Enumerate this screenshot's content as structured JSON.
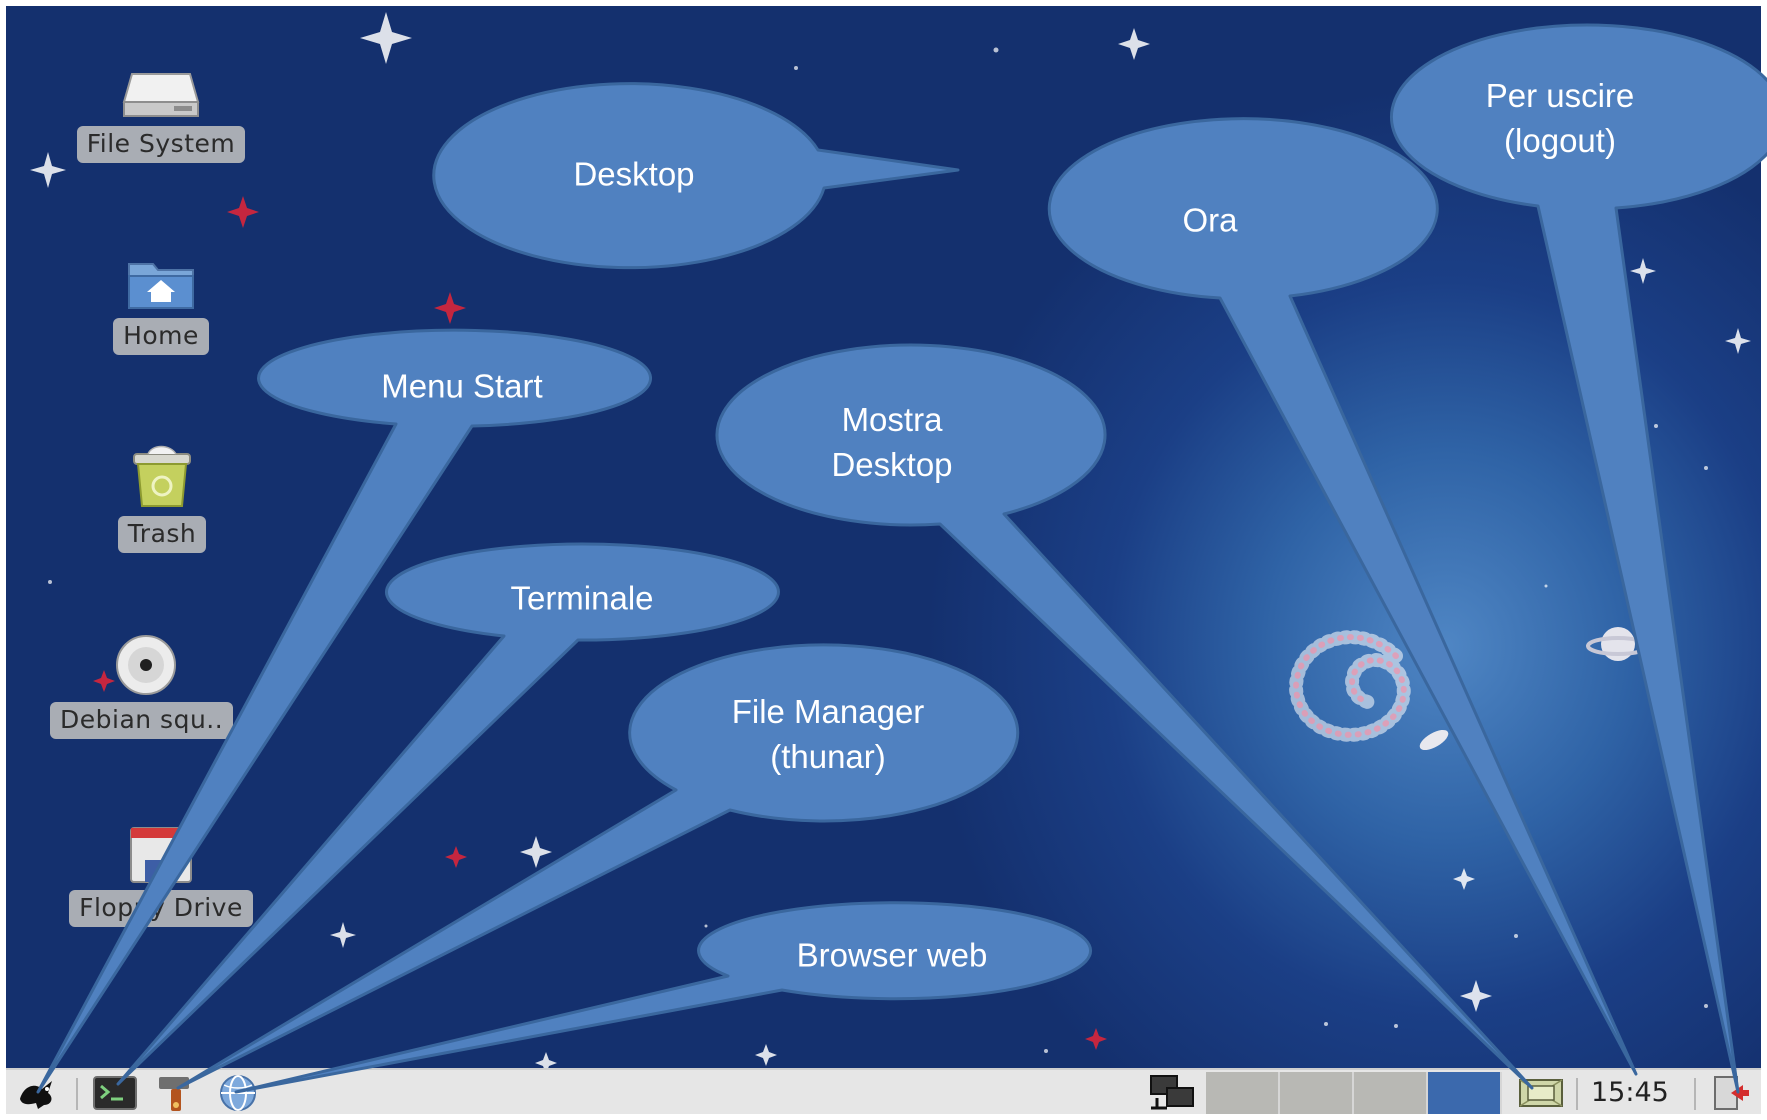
{
  "desktop_icons": [
    {
      "label": "File System",
      "icon": "harddisk-icon"
    },
    {
      "label": "Home",
      "icon": "home-folder-icon"
    },
    {
      "label": "Trash",
      "icon": "trash-icon"
    },
    {
      "label": "Debian squ..",
      "icon": "cdrom-icon"
    },
    {
      "label": "Floppy Drive",
      "icon": "floppy-icon"
    }
  ],
  "callouts": {
    "desktop": "Desktop",
    "ora": "Ora",
    "logout_line1": "Per uscire",
    "logout_line2": "(logout)",
    "menu_start": "Menu Start",
    "mostra_line1": "Mostra",
    "mostra_line2": "Desktop",
    "terminale": "Terminale",
    "filemanager_line1": "File Manager",
    "filemanager_line2": "(thunar)",
    "browser": "Browser web"
  },
  "taskbar": {
    "launchers": [
      "start-menu-icon",
      "terminal-icon",
      "file-manager-icon",
      "web-browser-icon"
    ],
    "tray": [
      "network-icon",
      "show-desktop-icon",
      "logout-icon"
    ],
    "workspaces": [
      {
        "index": 1,
        "active": false
      },
      {
        "index": 2,
        "active": false
      },
      {
        "index": 3,
        "active": false
      },
      {
        "index": 4,
        "active": true
      }
    ],
    "clock": "15:45"
  },
  "colors": {
    "callout_fill": "#5081c0",
    "callout_stroke": "#3a679e",
    "wallpaper": "#1d4389",
    "taskbar": "#e6e6e6"
  }
}
